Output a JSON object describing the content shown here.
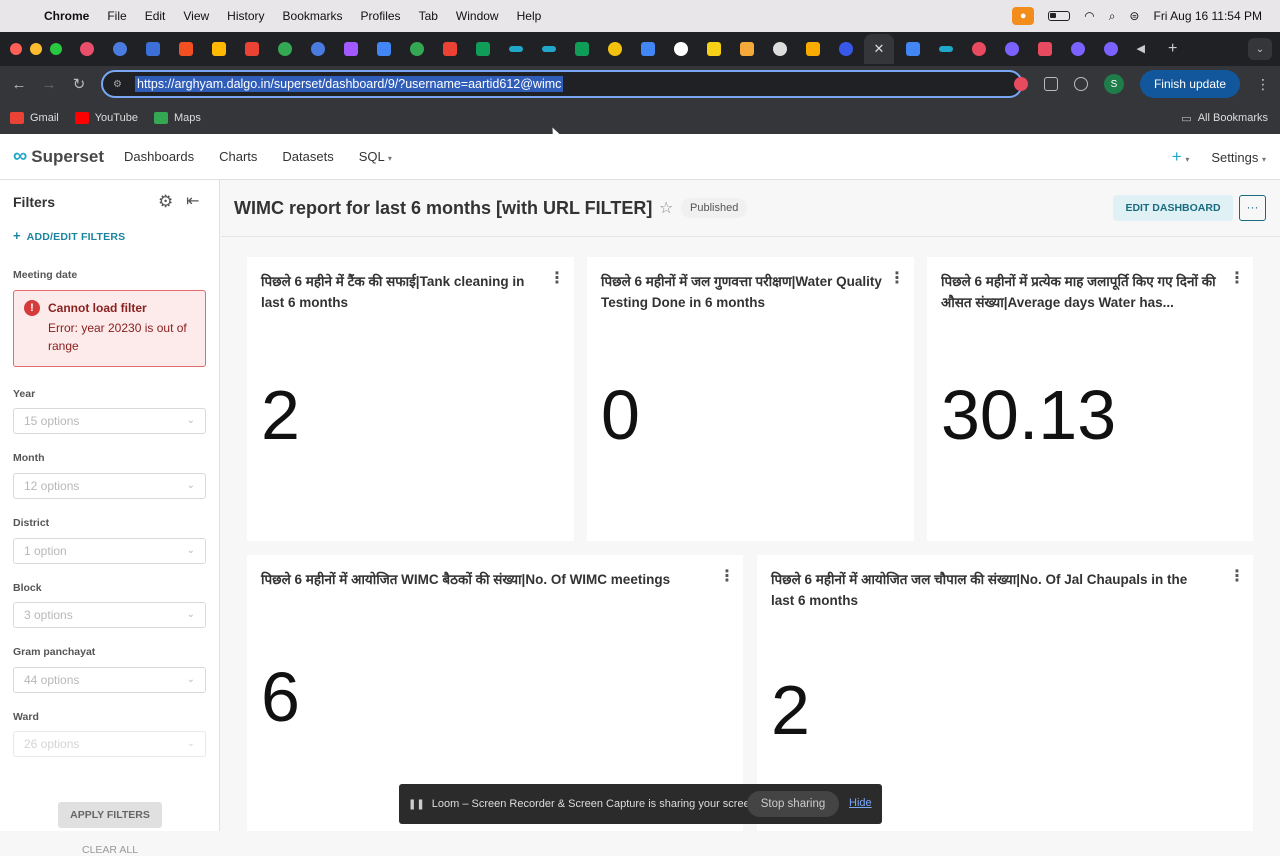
{
  "macos_menu": {
    "app": "Chrome",
    "items": [
      "File",
      "Edit",
      "View",
      "History",
      "Bookmarks",
      "Profiles",
      "Tab",
      "Window",
      "Help"
    ],
    "datetime": "Fri Aug 16  11:54 PM"
  },
  "browser": {
    "url": "https://arghyam.dalgo.in/superset/dashboard/9/?username=aartid612@wimc",
    "finish_update": "Finish update",
    "profile_initial": "S",
    "bookmarks": [
      "Gmail",
      "YouTube",
      "Maps"
    ],
    "all_bookmarks": "All Bookmarks"
  },
  "superset_nav": {
    "logo_text": "Superset",
    "items": [
      "Dashboards",
      "Charts",
      "Datasets",
      "SQL"
    ],
    "settings": "Settings"
  },
  "filters": {
    "heading": "Filters",
    "add_edit": "ADD/EDIT FILTERS",
    "meeting_date_label": "Meeting date",
    "error_title": "Cannot load filter",
    "error_message": "Error: year 20230 is out of range",
    "fields": [
      {
        "label": "Year",
        "placeholder": "15 options"
      },
      {
        "label": "Month",
        "placeholder": "12 options"
      },
      {
        "label": "District",
        "placeholder": "1 option"
      },
      {
        "label": "Block",
        "placeholder": "3 options"
      },
      {
        "label": "Gram panchayat",
        "placeholder": "44 options"
      },
      {
        "label": "Ward",
        "placeholder": "26 options"
      }
    ],
    "apply": "APPLY FILTERS",
    "clear": "CLEAR ALL"
  },
  "dashboard": {
    "title": "WIMC report for last 6 months [with URL FILTER]",
    "status": "Published",
    "edit_button": "EDIT DASHBOARD",
    "more_button": "···",
    "cards": [
      {
        "title": "पिछले 6 महीने में टैंक की सफाई|Tank cleaning in last 6 months",
        "value": "2"
      },
      {
        "title": "पिछले 6 महीनों में जल गुणवत्ता परीक्षण|Water Quality Testing Done in 6 months",
        "value": "0"
      },
      {
        "title": "पिछले 6 महीनों में प्रत्येक माह जलापूर्ति किए गए दिनों की औसत संख्या|Average days Water has...",
        "value": "30.13"
      },
      {
        "title": "पिछले 6 महीनों में आयोजित WIMC बैठकों की संख्या|No. Of WIMC meetings",
        "value": "6"
      },
      {
        "title": "पिछले 6 महीनों में आयोजित जल चौपाल की संख्या|No. Of Jal Chaupals in the last 6 months",
        "value": "2"
      }
    ]
  },
  "loom": {
    "message": "Loom – Screen Recorder & Screen Capture is sharing your screen.",
    "stop": "Stop sharing",
    "hide": "Hide"
  }
}
